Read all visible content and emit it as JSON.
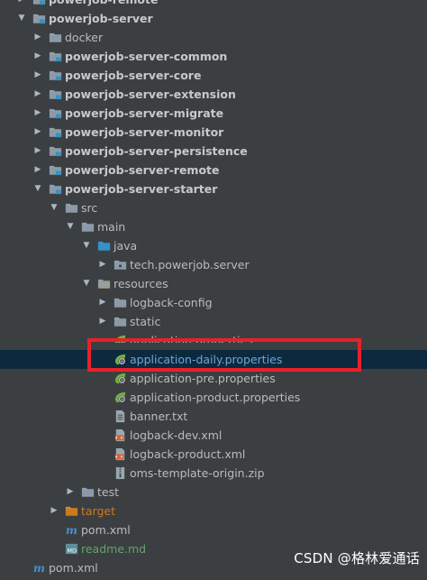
{
  "tree": [
    {
      "label": "powerjob-remote",
      "indent": 0,
      "expanded": false,
      "icon": "module-folder-icon",
      "style": "bold"
    },
    {
      "label": "powerjob-server",
      "indent": 0,
      "expanded": true,
      "icon": "module-folder-icon",
      "style": "bold"
    },
    {
      "label": "docker",
      "indent": 1,
      "expanded": false,
      "icon": "folder-icon",
      "style": "normal"
    },
    {
      "label": "powerjob-server-common",
      "indent": 1,
      "expanded": false,
      "icon": "module-folder-icon",
      "style": "bold"
    },
    {
      "label": "powerjob-server-core",
      "indent": 1,
      "expanded": false,
      "icon": "module-folder-icon",
      "style": "bold"
    },
    {
      "label": "powerjob-server-extension",
      "indent": 1,
      "expanded": false,
      "icon": "module-folder-icon",
      "style": "bold"
    },
    {
      "label": "powerjob-server-migrate",
      "indent": 1,
      "expanded": false,
      "icon": "module-folder-icon",
      "style": "bold"
    },
    {
      "label": "powerjob-server-monitor",
      "indent": 1,
      "expanded": false,
      "icon": "module-folder-icon",
      "style": "bold"
    },
    {
      "label": "powerjob-server-persistence",
      "indent": 1,
      "expanded": false,
      "icon": "module-folder-icon",
      "style": "bold"
    },
    {
      "label": "powerjob-server-remote",
      "indent": 1,
      "expanded": false,
      "icon": "module-folder-icon",
      "style": "bold"
    },
    {
      "label": "powerjob-server-starter",
      "indent": 1,
      "expanded": true,
      "icon": "module-folder-icon",
      "style": "bold"
    },
    {
      "label": "src",
      "indent": 2,
      "expanded": true,
      "icon": "folder-icon",
      "style": "normal"
    },
    {
      "label": "main",
      "indent": 3,
      "expanded": true,
      "icon": "folder-icon",
      "style": "normal"
    },
    {
      "label": "java",
      "indent": 4,
      "expanded": true,
      "icon": "source-folder-icon",
      "style": "normal"
    },
    {
      "label": "tech.powerjob.server",
      "indent": 5,
      "expanded": false,
      "icon": "package-icon",
      "style": "normal"
    },
    {
      "label": "resources",
      "indent": 4,
      "expanded": true,
      "icon": "resources-folder-icon",
      "style": "normal"
    },
    {
      "label": "logback-config",
      "indent": 5,
      "expanded": false,
      "icon": "folder-icon",
      "style": "normal"
    },
    {
      "label": "static",
      "indent": 5,
      "expanded": false,
      "icon": "folder-icon",
      "style": "normal"
    },
    {
      "label": "application.properties",
      "indent": 5,
      "expanded": null,
      "icon": "spring-properties-icon",
      "style": "normal",
      "partially_hidden": true
    },
    {
      "label": "application-daily.properties",
      "indent": 5,
      "expanded": null,
      "icon": "spring-properties-icon",
      "style": "selected"
    },
    {
      "label": "application-pre.properties",
      "indent": 5,
      "expanded": null,
      "icon": "spring-properties-icon",
      "style": "normal"
    },
    {
      "label": "application-product.properties",
      "indent": 5,
      "expanded": null,
      "icon": "spring-properties-icon",
      "style": "normal"
    },
    {
      "label": "banner.txt",
      "indent": 5,
      "expanded": null,
      "icon": "text-file-icon",
      "style": "normal"
    },
    {
      "label": "logback-dev.xml",
      "indent": 5,
      "expanded": null,
      "icon": "xml-file-icon",
      "style": "normal"
    },
    {
      "label": "logback-product.xml",
      "indent": 5,
      "expanded": null,
      "icon": "xml-file-icon",
      "style": "normal"
    },
    {
      "label": "oms-template-origin.zip",
      "indent": 5,
      "expanded": null,
      "icon": "zip-file-icon",
      "style": "normal"
    },
    {
      "label": "test",
      "indent": 3,
      "expanded": false,
      "icon": "folder-icon",
      "style": "normal"
    },
    {
      "label": "target",
      "indent": 2,
      "expanded": false,
      "icon": "excluded-folder-icon",
      "style": "orange"
    },
    {
      "label": "pom.xml",
      "indent": 2,
      "expanded": null,
      "icon": "maven-icon",
      "style": "normal"
    },
    {
      "label": "readme.md",
      "indent": 2,
      "expanded": null,
      "icon": "markdown-icon",
      "style": "green"
    },
    {
      "label": "pom.xml",
      "indent": 0,
      "expanded": null,
      "icon": "maven-icon",
      "style": "normal"
    }
  ],
  "watermark": "CSDN @格林爱通话",
  "colors": {
    "background": "#3c3f41",
    "selection": "#0d293e",
    "highlight_box": "#e8212a",
    "excluded": "#ce7a1b",
    "markdown": "#62a36b"
  }
}
